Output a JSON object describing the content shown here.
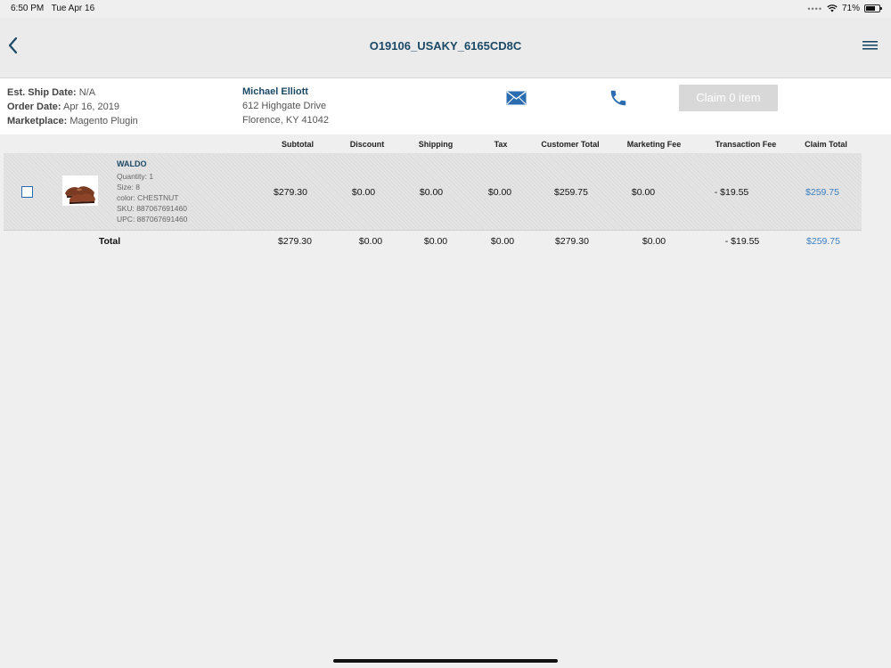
{
  "status_bar": {
    "time": "6:50 PM",
    "date": "Tue Apr 16",
    "battery": "71%",
    "battery_level": 0.71
  },
  "nav": {
    "title": "O19106_USAKY_6165CD8C"
  },
  "order_info": {
    "ship_label": "Est. Ship Date:",
    "ship_value": "N/A",
    "order_date_label": "Order Date:",
    "order_date_value": "Apr 16, 2019",
    "marketplace_label": "Marketplace:",
    "marketplace_value": "Magento Plugin"
  },
  "customer": {
    "name": "Michael Elliott",
    "address_line1": "612 Highgate Drive",
    "address_line2": "Florence, KY 41042"
  },
  "claim_button": "Claim 0 item",
  "table": {
    "columns": [
      "Subtotal",
      "Discount",
      "Shipping",
      "Tax",
      "Customer Total",
      "Marketing Fee",
      "Transaction Fee",
      "Claim Total"
    ],
    "item": {
      "name": "WALDO",
      "quantity": "Quantity: 1",
      "size": "Size: 8",
      "color": "color: CHESTNUT",
      "sku": "SKU: 887067691460",
      "upc": "UPC: 887067691460",
      "values": [
        "$279.30",
        "$0.00",
        "$0.00",
        "$0.00",
        "$259.75",
        "$0.00",
        "- $19.55",
        "$259.75"
      ]
    },
    "total": {
      "label": "Total",
      "values": [
        "$279.30",
        "$0.00",
        "$0.00",
        "$0.00",
        "$279.30",
        "$0.00",
        "- $19.55",
        "$259.75"
      ]
    }
  },
  "colors": {
    "accent": "#1c4966",
    "link": "#3a7fbf",
    "disabled_button": "#d8d8d8"
  }
}
